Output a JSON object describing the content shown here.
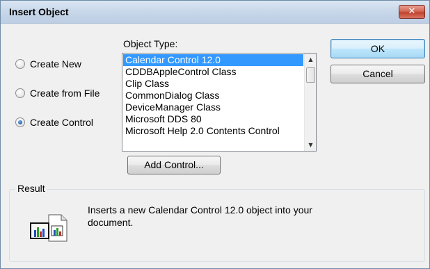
{
  "window": {
    "title": "Insert Object",
    "close_glyph": "✕"
  },
  "options": [
    {
      "label": "Create New",
      "checked": false
    },
    {
      "label": "Create from File",
      "checked": false
    },
    {
      "label": "Create Control",
      "checked": true
    }
  ],
  "object_type": {
    "label": "Object Type:",
    "items": [
      "Calendar Control 12.0",
      "CDDBAppleControl Class",
      "Clip Class",
      "CommonDialog Class",
      "DeviceManager Class",
      "Microsoft DDS 80",
      "Microsoft Help 2.0 Contents Control"
    ],
    "selected_index": 0
  },
  "buttons": {
    "ok": "OK",
    "cancel": "Cancel",
    "add_control": "Add Control..."
  },
  "result": {
    "label": "Result",
    "text": "Inserts a new Calendar Control 12.0 object into your document.",
    "icon": "object-document-icon"
  },
  "colors": {
    "selection": "#3399ff",
    "close_button": "#c0432e"
  }
}
